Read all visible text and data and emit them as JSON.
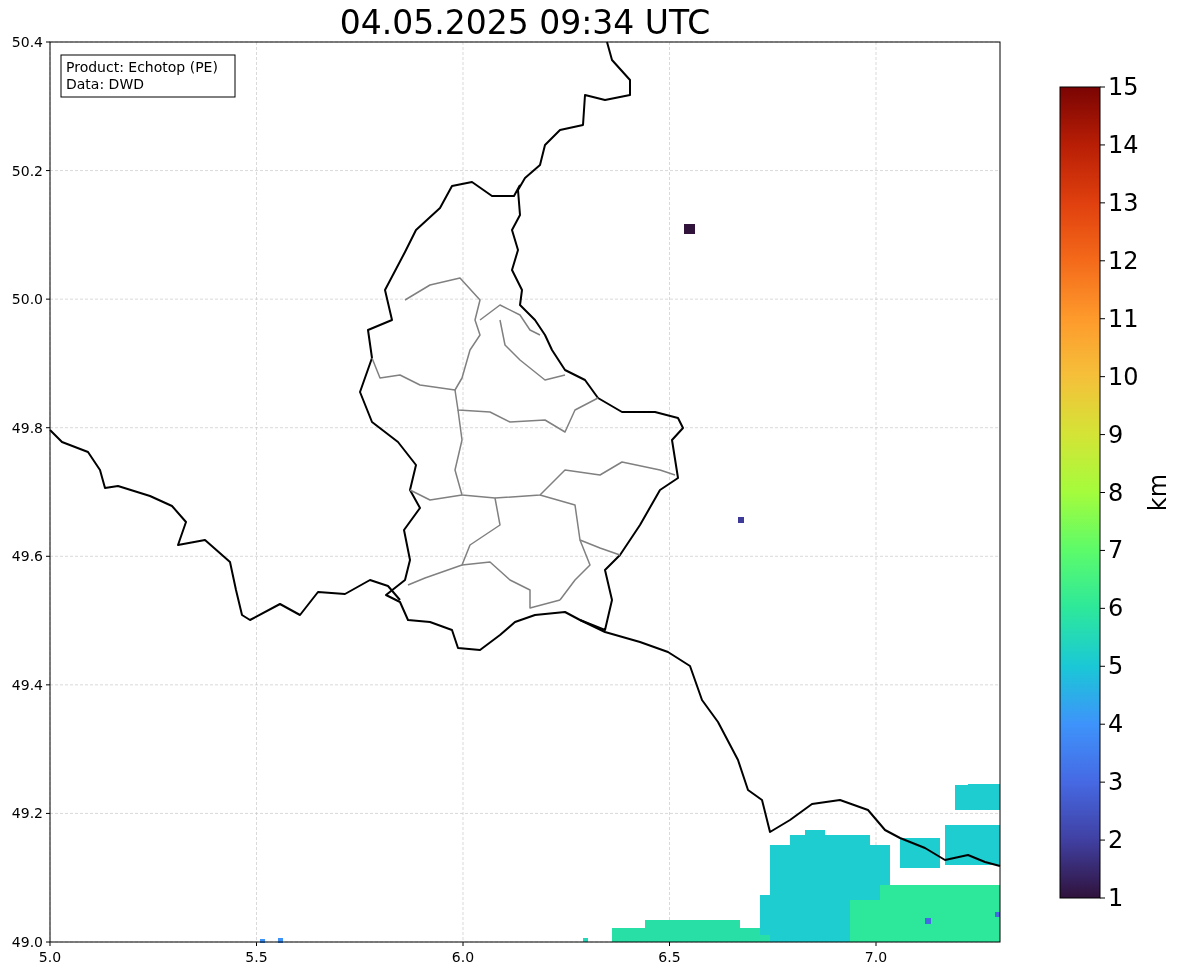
{
  "title": "04.05.2025 09:34 UTC",
  "info_box": [
    "Product: Echotop (PE)",
    "Data: DWD"
  ],
  "map": {
    "x_ticks": [
      "5.0",
      "5.5",
      "6.0",
      "6.5",
      "7.0"
    ],
    "y_ticks": [
      "50.4",
      "50.2",
      "50.0",
      "49.8",
      "49.6",
      "49.4",
      "49.2",
      "49.0"
    ]
  },
  "colorbar": {
    "label": "km",
    "ticks": [
      "15",
      "14",
      "13",
      "12",
      "11",
      "10",
      "9",
      "8",
      "7",
      "6",
      "5",
      "4",
      "3",
      "2",
      "1"
    ]
  }
}
